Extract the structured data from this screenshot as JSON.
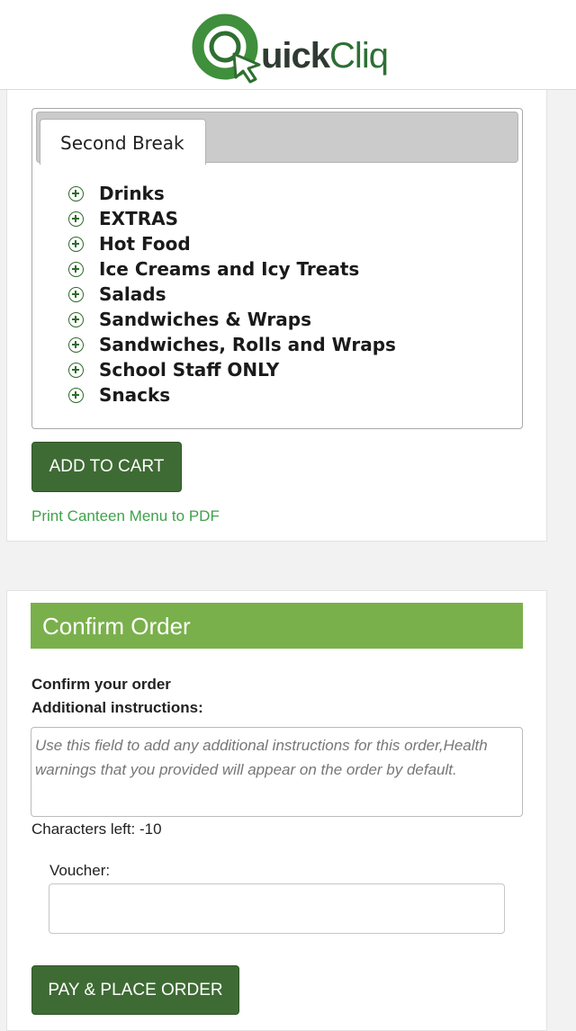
{
  "header": {
    "logo_text_dark": "uick",
    "logo_text_green": "Cliq",
    "logo_brand": "QuickCliq",
    "colors": {
      "logo_green": "#3f8f3c",
      "logo_dark": "#2f3b32"
    }
  },
  "menu": {
    "tab_label": "Second Break",
    "categories": [
      {
        "label": "Drinks",
        "icon": "plus-circle-icon"
      },
      {
        "label": "EXTRAS",
        "icon": "plus-circle-icon"
      },
      {
        "label": "Hot Food",
        "icon": "plus-circle-icon"
      },
      {
        "label": "Ice Creams and Icy Treats",
        "icon": "plus-circle-icon"
      },
      {
        "label": "Salads",
        "icon": "plus-circle-icon"
      },
      {
        "label": "Sandwiches & Wraps",
        "icon": "plus-circle-icon"
      },
      {
        "label": "Sandwiches, Rolls and Wraps",
        "icon": "plus-circle-icon"
      },
      {
        "label": "School Staff ONLY",
        "icon": "plus-circle-icon"
      },
      {
        "label": "Snacks",
        "icon": "plus-circle-icon"
      }
    ],
    "add_to_cart_label": "ADD TO CART",
    "print_link_label": "Print Canteen Menu to PDF"
  },
  "confirm": {
    "heading": "Confirm Order",
    "confirm_label": "Confirm your order",
    "instructions_label": "Additional instructions:",
    "instructions_placeholder": "Use this field to add any additional instructions for this order,Health warnings that you provided will appear on the order by default.",
    "instructions_value": "",
    "chars_left": "Characters left: -10",
    "voucher_label": "Voucher:",
    "voucher_value": "",
    "pay_button_label": "PAY & PLACE ORDER"
  },
  "colors": {
    "button_green": "#3e6b34",
    "header_green": "#7ab04b",
    "link_green": "#3fa24a"
  }
}
